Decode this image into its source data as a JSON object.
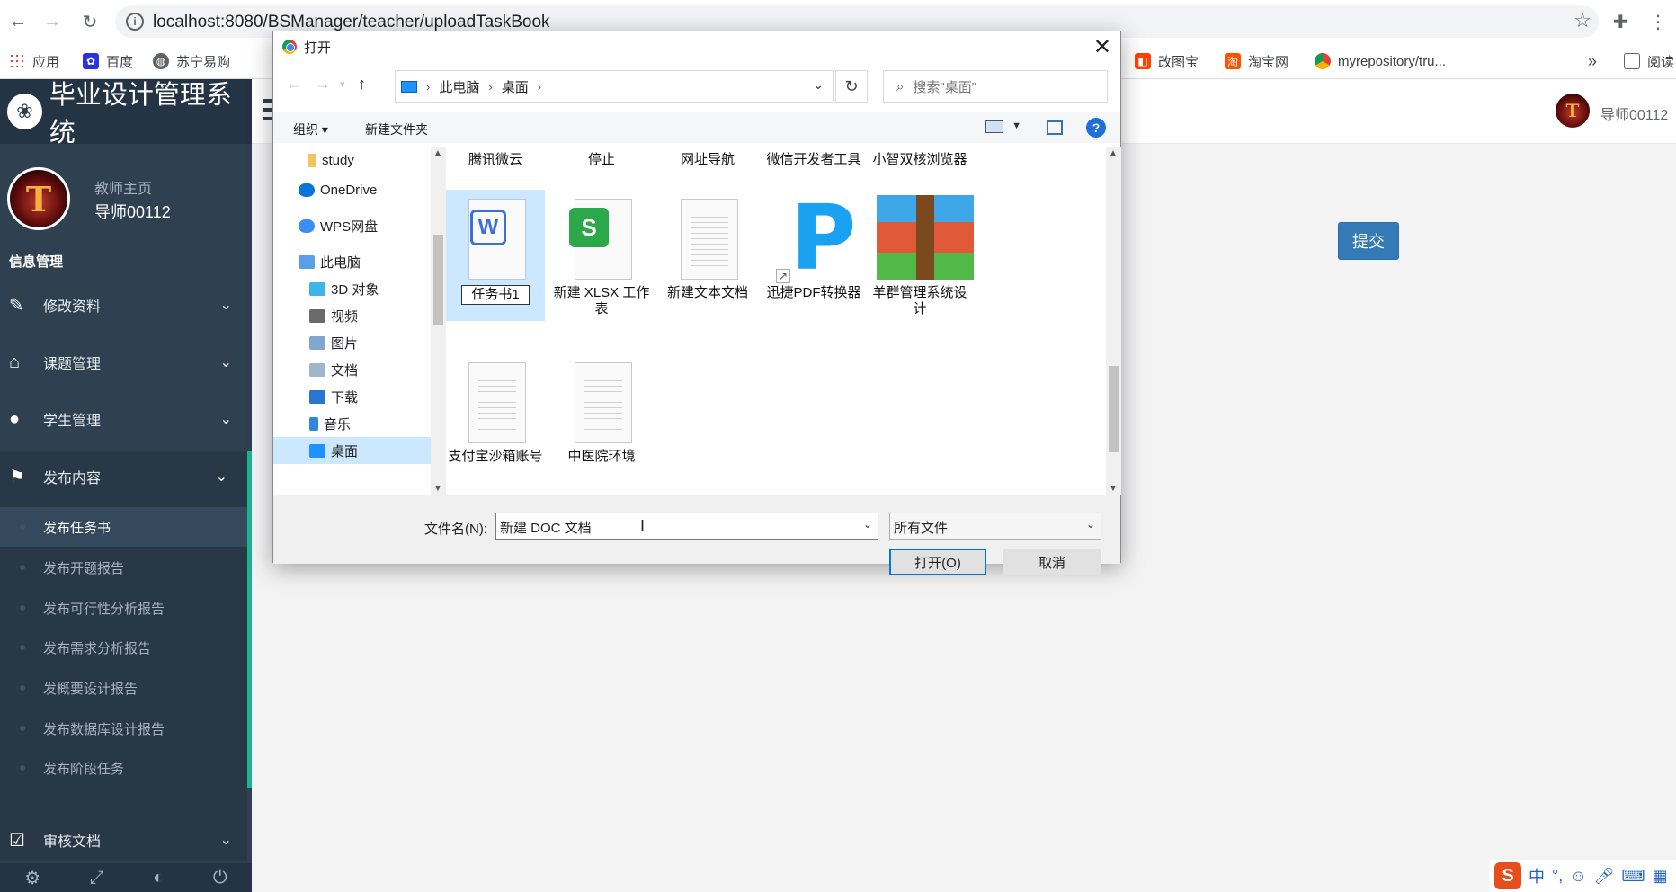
{
  "browser": {
    "url": "localhost:8080/BSManager/teacher/uploadTaskBook",
    "back_icon": "arrow-left-icon",
    "forward_icon": "arrow-right-icon",
    "reload_icon": "reload-icon",
    "bookmarks_left": [
      {
        "label": "应用",
        "color": "#4285f4"
      },
      {
        "label": "百度",
        "color": "#2932e1"
      },
      {
        "label": "苏宁易购",
        "color": "#5f6368"
      }
    ],
    "bookmarks_right": [
      {
        "label": "改图宝",
        "color": "#ff4400"
      },
      {
        "label": "淘宝网",
        "color": "#ff5000"
      },
      {
        "label": "myrepository/tru...",
        "color": "#34a853"
      }
    ],
    "bookmarks_more": "»",
    "reading_list": "阅读"
  },
  "app": {
    "title": "毕业设计管理系统",
    "role_label": "教师主页",
    "username": "导师00112",
    "section_label": "信息管理",
    "menu": [
      {
        "label": "修改资料",
        "icon": "edit-icon"
      },
      {
        "label": "课题管理",
        "icon": "tags-icon"
      },
      {
        "label": "学生管理",
        "icon": "user-icon"
      },
      {
        "label": "发布内容",
        "icon": "flag-icon"
      },
      {
        "label": "审核文档",
        "icon": "check-square-icon"
      }
    ],
    "submenu": [
      "发布任务书",
      "发布开题报告",
      "发布可行性分析报告",
      "发布需求分析报告",
      "发概要设计报告",
      "发布数据库设计报告",
      "发布阶段任务"
    ],
    "header_user": "导师00112",
    "submit_label": "提交"
  },
  "dialog": {
    "title": "打开",
    "breadcrumb": [
      "此电脑",
      "桌面"
    ],
    "search_placeholder": "搜索\"桌面\"",
    "toolbar": {
      "organize": "组织 ▾",
      "new_folder": "新建文件夹",
      "help": "?"
    },
    "tree": [
      {
        "label": "study",
        "color": "#f2c55c"
      },
      {
        "label": "OneDrive",
        "color": "#0a74d9"
      },
      {
        "label": "WPS网盘",
        "color": "#3a8ef6"
      },
      {
        "label": "此电脑",
        "color": "#5aa0e6"
      },
      {
        "label": "3D 对象",
        "color": "#3cb6e8"
      },
      {
        "label": "视频",
        "color": "#6b6b6b"
      },
      {
        "label": "图片",
        "color": "#7fa7cf"
      },
      {
        "label": "文档",
        "color": "#9fb6cc"
      },
      {
        "label": "下载",
        "color": "#2a74d6"
      },
      {
        "label": "音乐",
        "color": "#2f86e0"
      },
      {
        "label": "桌面",
        "color": "#1e90ff"
      }
    ],
    "files_top_row": [
      "腾讯微云",
      "停止",
      "网址导航",
      "微信开发者工具",
      "小智双核浏览器"
    ],
    "files": [
      {
        "label": "任务书1",
        "type": "wps-doc"
      },
      {
        "label": "新建 XLSX 工作表",
        "type": "wps-xlsx"
      },
      {
        "label": "新建文本文档",
        "type": "txt"
      },
      {
        "label": "迅捷PDF转换器",
        "type": "pdf-app"
      },
      {
        "label": "羊群管理系统设计",
        "type": "archive"
      },
      {
        "label": "支付宝沙箱账号",
        "type": "txt"
      },
      {
        "label": "中医院环境",
        "type": "txt"
      }
    ],
    "filename_label": "文件名(N):",
    "filename_value": "新建 DOC 文档",
    "filetype_value": "所有文件",
    "open_label": "打开(O)",
    "cancel_label": "取消"
  },
  "ime": {
    "lang": "中",
    "punct": "°,"
  }
}
